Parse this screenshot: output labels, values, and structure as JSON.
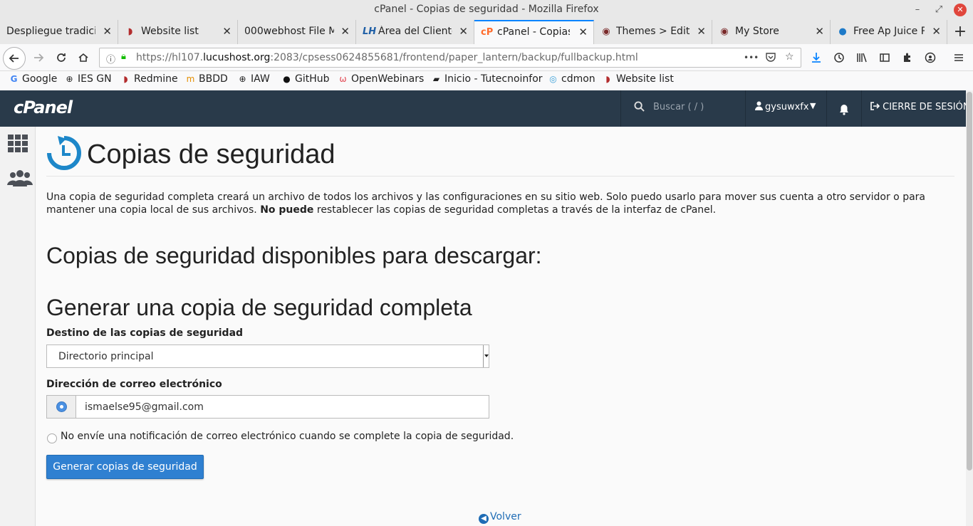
{
  "window": {
    "title": "cPanel - Copias de seguridad - Mozilla Firefox",
    "minimize_glyph": "–",
    "restore_glyph": "⤢",
    "close_glyph": "✕"
  },
  "tabs": [
    {
      "label": "Despliegue tradicio",
      "icon": "page-icon"
    },
    {
      "label": "Website list",
      "icon": "redmine-icon"
    },
    {
      "label": "000webhost File M",
      "icon": "page-icon"
    },
    {
      "label": "Área del Cliente",
      "icon": "lucushost-icon"
    },
    {
      "label": "cPanel - Copias",
      "icon": "cpanel-icon",
      "active": true
    },
    {
      "label": "Themes > Edit:",
      "icon": "ghost-icon"
    },
    {
      "label": "My Store",
      "icon": "ghost-icon"
    },
    {
      "label": "Free Ap Juice Pr",
      "icon": "globe-icon"
    }
  ],
  "tab_close_glyph": "✕",
  "new_tab_glyph": "+",
  "navbar": {
    "url_prefix": "https://hl107.",
    "url_domain": "lucushost.org",
    "url_rest": ":2083/cpsess0624855681/frontend/paper_lantern/backup/fullbackup.html",
    "page_actions_glyph": "•••"
  },
  "bookmarks": [
    {
      "label": "Google",
      "icon": "google-icon"
    },
    {
      "label": "IES GN",
      "icon": "globe-icon"
    },
    {
      "label": "Redmine",
      "icon": "redmine-icon"
    },
    {
      "label": "BBDD",
      "icon": "mysql-icon"
    },
    {
      "label": "IAW",
      "icon": "globe-icon"
    },
    {
      "label": "GitHub",
      "icon": "github-icon"
    },
    {
      "label": "OpenWebinars",
      "icon": "openwebinars-icon"
    },
    {
      "label": "Inicio - Tutecnoinfor",
      "icon": "book-icon"
    },
    {
      "label": "cdmon",
      "icon": "cdmon-icon"
    },
    {
      "label": "Website list",
      "icon": "redmine-icon"
    }
  ],
  "cpanel": {
    "logo": "cPanel",
    "search_placeholder": "Buscar ( / )",
    "username": "gysuwxfx",
    "logout": "CIERRE DE SESIÓN",
    "accent_color": "#293a4a"
  },
  "page": {
    "title": "Copias de seguridad",
    "intro_part1": "Una copia de seguridad completa creará un archivo de todos los archivos y las configuraciones en su sitio web. Solo puedo usarlo para mover sus cuenta a otro servidor o para mantener una copia local de sus archivos. ",
    "intro_bold": "No puede",
    "intro_part2": " restablecer las copias de seguridad completas a través de la interfaz de cPanel.",
    "available_heading": "Copias de seguridad disponibles para descargar:",
    "generate_heading": "Generar una copia de seguridad completa",
    "destination_label": "Destino de las copias de seguridad",
    "destination_value": "Directorio principal",
    "email_label": "Dirección de correo electrónico",
    "email_value": "ismaelse95@gmail.com",
    "no_email_label": "No envíe una notificación de correo electrónico cuando se complete la copia de seguridad.",
    "generate_button": "Generar copias de seguridad",
    "back_link": "Volver"
  }
}
